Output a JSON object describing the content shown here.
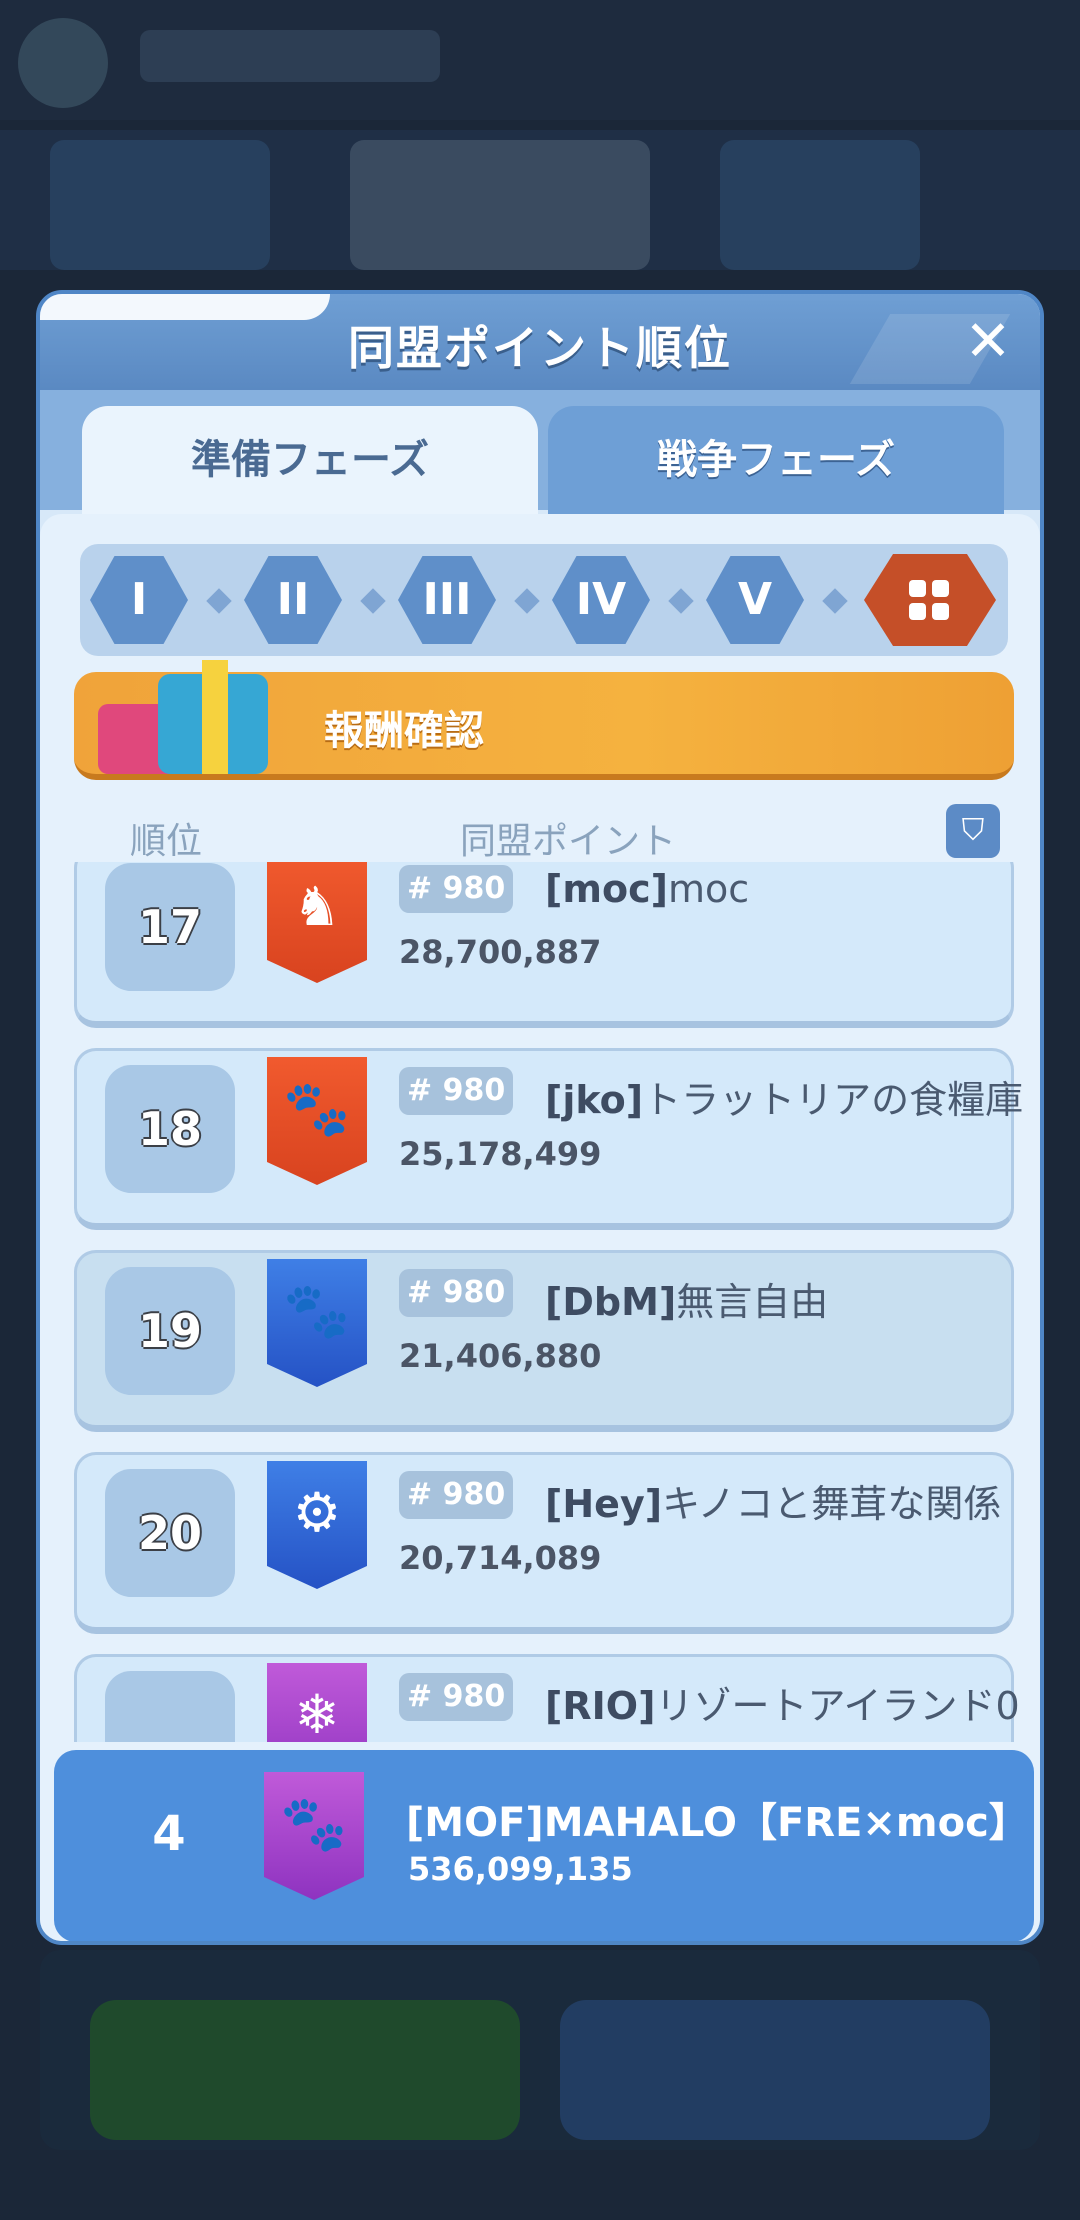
{
  "modal": {
    "title": "同盟ポイント順位",
    "close_icon": "close-icon"
  },
  "tabs": [
    {
      "label": "準備フェーズ",
      "active": true
    },
    {
      "label": "戦争フェーズ",
      "active": false
    }
  ],
  "stages": [
    "I",
    "II",
    "III",
    "IV",
    "V"
  ],
  "stage_all_icon": "grid-icon",
  "reward": {
    "label": "報酬確認",
    "icon": "gift-icon"
  },
  "columns": {
    "rank": "順位",
    "points": "同盟ポイント",
    "filter_icon": "filter-icon"
  },
  "rows": [
    {
      "rank": "17",
      "badge": "# 980",
      "tag": "[moc]",
      "name": "moc",
      "points": "28,700,887",
      "banner_color": "red",
      "banner_icon": "moose-icon"
    },
    {
      "rank": "18",
      "badge": "# 980",
      "tag": "[jko]",
      "name": "トラットリアの食糧庫",
      "points": "25,178,499",
      "banner_color": "red",
      "banner_icon": "paw-icon"
    },
    {
      "rank": "19",
      "badge": "# 980",
      "tag": "[DbM]",
      "name": "無言自由",
      "points": "21,406,880",
      "banner_color": "blue",
      "banner_icon": "paw-icon"
    },
    {
      "rank": "20",
      "badge": "# 980",
      "tag": "[Hey]",
      "name": "キノコと舞茸な関係",
      "points": "20,714,089",
      "banner_color": "blue",
      "banner_icon": "cannon-icon"
    },
    {
      "rank": "",
      "badge": "# 980",
      "tag": "[RIO]",
      "name": "リゾートアイランド0",
      "points": "",
      "banner_color": "purple",
      "banner_icon": "snowflake-icon"
    }
  ],
  "own": {
    "rank": "4",
    "name": "[MOF]MAHALO【FRE×moc】",
    "points": "536,099,135",
    "banner_color": "purple",
    "banner_icon": "paw-icon"
  }
}
